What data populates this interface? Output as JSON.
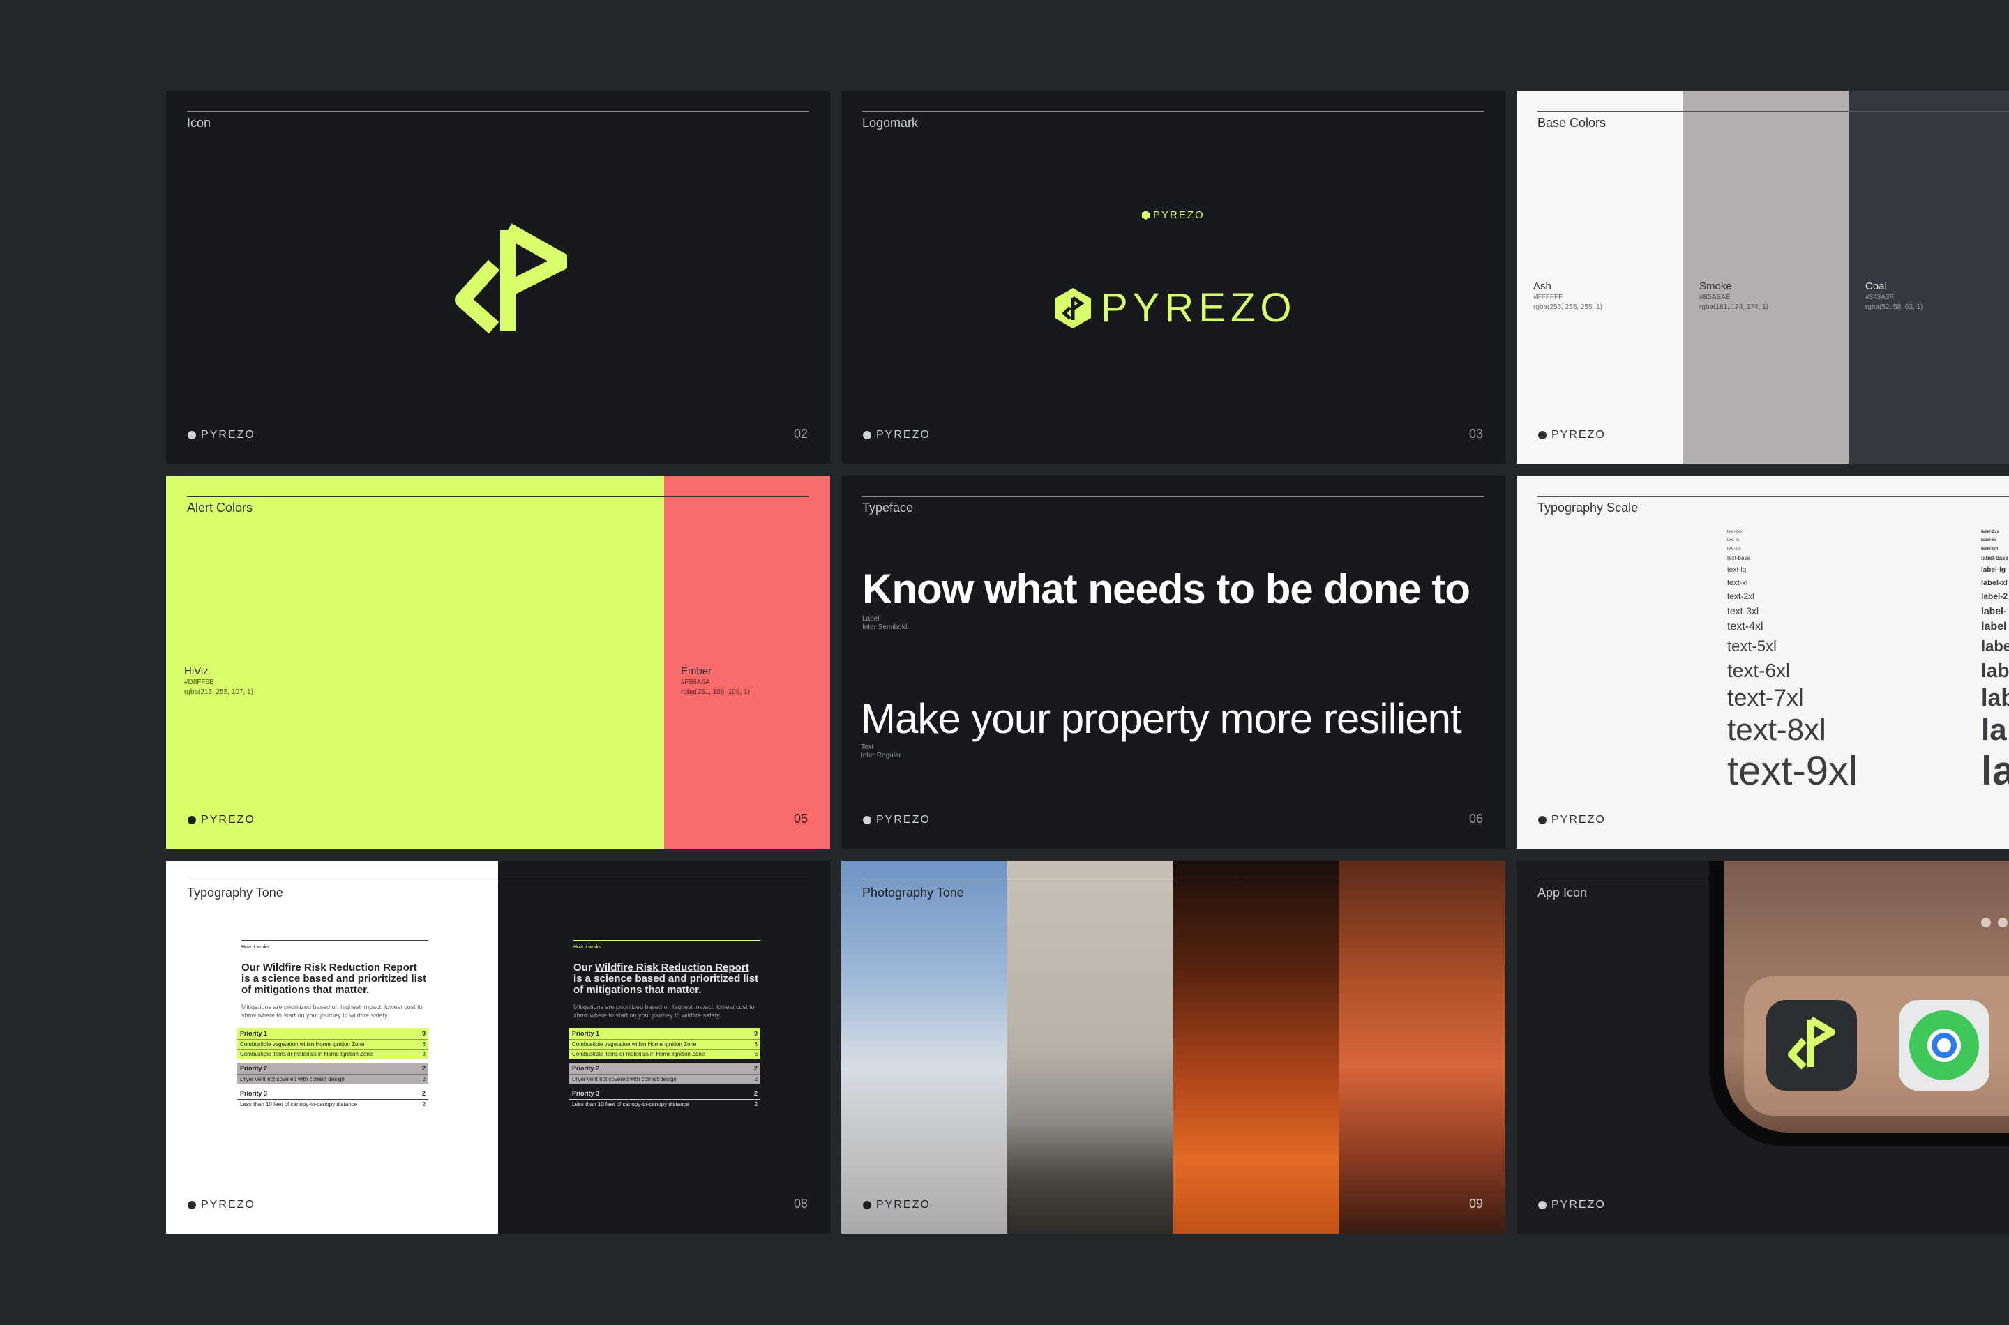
{
  "brand": "PYREZO",
  "colors": {
    "hiviz": "#D8FF6B",
    "ember": "#F96A6A",
    "coal": "#343A3F",
    "ash": "#FFFFFF",
    "smoke": "#B5AEAE"
  },
  "cards": {
    "icon": {
      "title": "Icon",
      "page": "02"
    },
    "logomark": {
      "title": "Logomark",
      "page": "03",
      "small_word": "PYREZO",
      "big_word": "PYREZO"
    },
    "base_colors": {
      "title": "Base Colors",
      "swatches": [
        {
          "name": "Ash",
          "hex": "#FFFFFF",
          "rgba": "rgba(255, 255, 255, 1)"
        },
        {
          "name": "Smoke",
          "hex": "#B5AEAE",
          "rgba": "rgba(181, 174, 174, 1)"
        },
        {
          "name": "Coal",
          "hex": "#343A3F",
          "rgba": "rgba(52, 58, 63, 1)"
        }
      ]
    },
    "alert_colors": {
      "title": "Alert Colors",
      "page": "05",
      "swatches": [
        {
          "name": "HiViz",
          "hex": "#D8FF6B",
          "rgba": "rgba(215, 255, 107, 1)"
        },
        {
          "name": "Ember",
          "hex": "#F86A6A",
          "rgba": "rgba(251, 106, 106, 1)"
        }
      ]
    },
    "typeface": {
      "title": "Typeface",
      "page": "06",
      "headline": "Know what needs to be done to",
      "headline_label": "Label",
      "headline_font": "Inter Semibold",
      "body": "Make your property more resilient",
      "body_label": "Text",
      "body_font": "Inter Regular"
    },
    "typography_scale": {
      "title": "Typography Scale",
      "text_items": [
        "text-2xs",
        "text-xs",
        "text-sm",
        "text-base",
        "text-lg",
        "text-xl",
        "text-2xl",
        "text-3xl",
        "text-4xl",
        "text-5xl",
        "text-6xl",
        "text-7xl",
        "text-8xl",
        "text-9xl"
      ],
      "label_items": [
        "label-2xs",
        "label-xs",
        "label-sm",
        "label-base",
        "label-lg",
        "label-xl",
        "label-2",
        "label-",
        "label",
        "labe",
        "lab",
        "lab",
        "la",
        "la"
      ]
    },
    "typography_tone": {
      "title": "Typography Tone",
      "page": "08",
      "eyebrow": "How it works",
      "heading_pre": "Our ",
      "heading_link": "Wildfire Risk Reduction Report",
      "heading_post": "is a science based and prioritized list of mitigations that matter.",
      "body": "Mitigations are prioritized based on highest impact, lowest cost to show where to start on your journey to wildfire safety.",
      "groups": [
        {
          "title": "Priority 1",
          "count": "9",
          "rows": [
            {
              "text": "Combustible vegetation within Home Ignition Zone",
              "n": "6"
            },
            {
              "text": "Combustible items or materials in Home Ignition Zone",
              "n": "3"
            }
          ]
        },
        {
          "title": "Priority 2",
          "count": "2",
          "rows": [
            {
              "text": "Dryer vent not covered with correct design",
              "n": "2"
            }
          ]
        },
        {
          "title": "Priority 3",
          "count": "2",
          "rows": [
            {
              "text": "Less than 10 feet of canopy-to-canopy distance",
              "n": "2"
            }
          ]
        }
      ]
    },
    "photography_tone": {
      "title": "Photography Tone",
      "page": "09"
    },
    "app_icon": {
      "title": "App Icon"
    }
  }
}
